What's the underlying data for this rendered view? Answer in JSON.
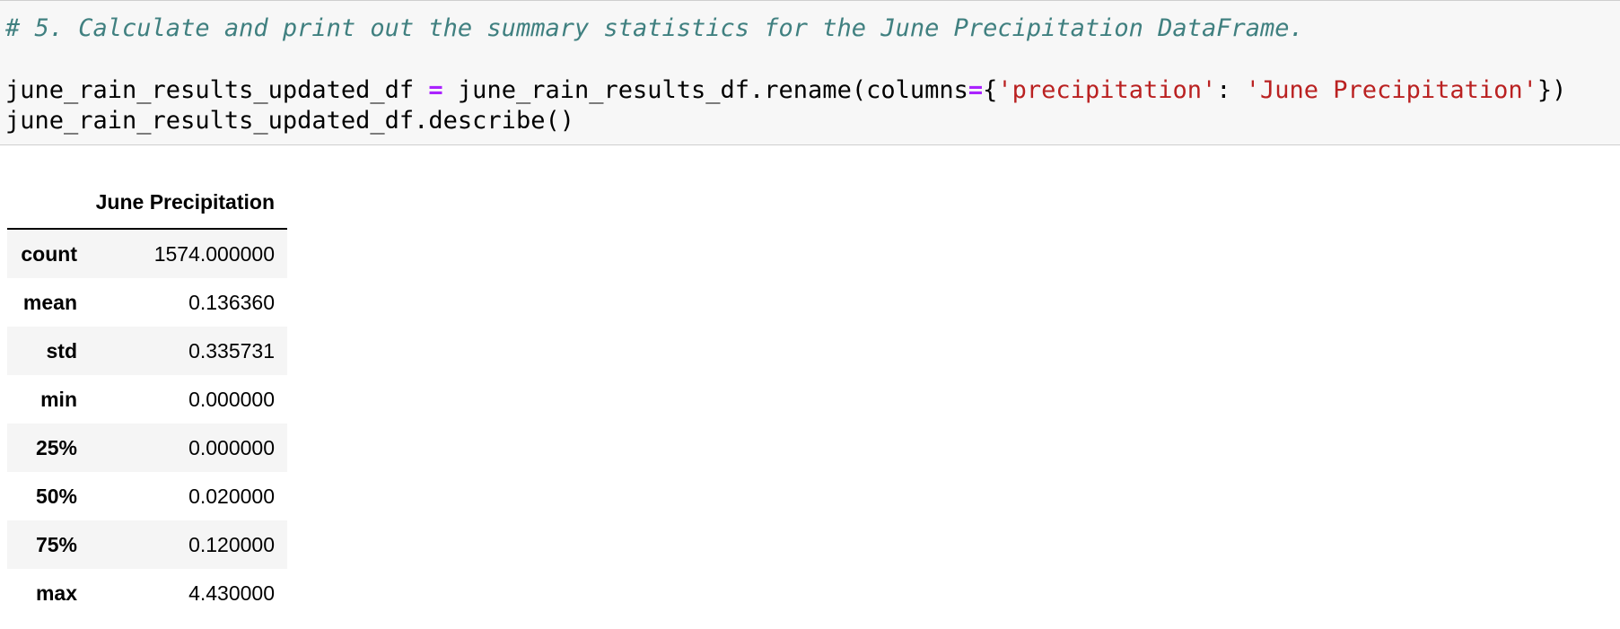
{
  "code_cell": {
    "comment": "# 5. Calculate and print out the summary statistics for the June Precipitation DataFrame.",
    "line1": {
      "target": "june_rain_results_updated_df ",
      "assign_op": "=",
      "call_prefix": " june_rain_results_df.rename(columns",
      "kw_op": "=",
      "brace_open": "{",
      "key_str": "'precipitation'",
      "colon": ": ",
      "value_str": "'June Precipitation'",
      "close": "})"
    },
    "line2": "june_rain_results_updated_df.describe()"
  },
  "output": {
    "column_header": "June Precipitation",
    "rows": [
      {
        "label": "count",
        "value": "1574.000000"
      },
      {
        "label": "mean",
        "value": "0.136360"
      },
      {
        "label": "std",
        "value": "0.335731"
      },
      {
        "label": "min",
        "value": "0.000000"
      },
      {
        "label": "25%",
        "value": "0.000000"
      },
      {
        "label": "50%",
        "value": "0.020000"
      },
      {
        "label": "75%",
        "value": "0.120000"
      },
      {
        "label": "max",
        "value": "4.430000"
      }
    ]
  },
  "colors": {
    "comment": "#408080",
    "operator": "#aa22ff",
    "string": "#ba2121",
    "cell_background": "#f7f7f7",
    "striped_row": "#f5f5f5"
  }
}
